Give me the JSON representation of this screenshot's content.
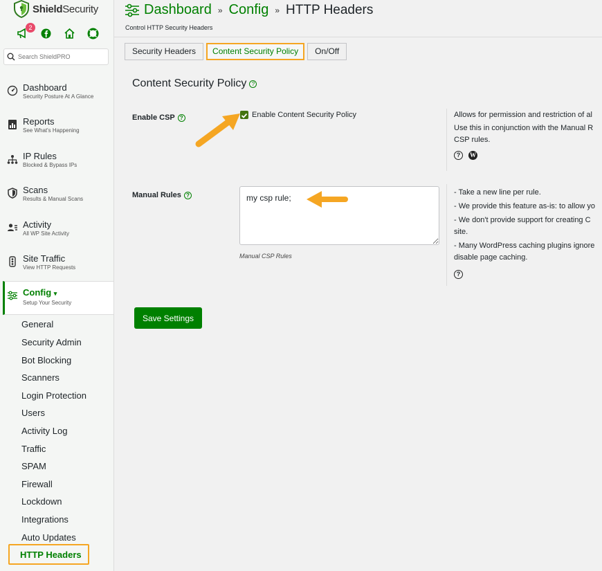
{
  "brand": {
    "name_a": "Shield",
    "name_b": "Security",
    "accent": "#008000",
    "highlight": "#f5a623"
  },
  "top_icons": {
    "notifications_count": "2",
    "icons": [
      "megaphone-icon",
      "facebook-icon",
      "home-icon",
      "support-icon"
    ]
  },
  "search": {
    "placeholder": "Search ShieldPRO"
  },
  "nav": [
    {
      "title": "Dashboard",
      "sub": "Security Posture At A Glance",
      "icon": "gauge-icon"
    },
    {
      "title": "Reports",
      "sub": "See What's Happening",
      "icon": "report-icon"
    },
    {
      "title": "IP Rules",
      "sub": "Blocked & Bypass IPs",
      "icon": "network-icon"
    },
    {
      "title": "Scans",
      "sub": "Results & Manual Scans",
      "icon": "shield-icon"
    },
    {
      "title": "Activity",
      "sub": "All WP Site Activity",
      "icon": "user-list-icon"
    },
    {
      "title": "Site Traffic",
      "sub": "View HTTP Requests",
      "icon": "traffic-icon"
    },
    {
      "title": "Config",
      "sub": "Setup Your Security",
      "icon": "sliders-icon"
    }
  ],
  "config_caret": "▾",
  "config_items": [
    "General",
    "Security Admin",
    "Bot Blocking",
    "Scanners",
    "Login Protection",
    "Users",
    "Activity Log",
    "Traffic",
    "SPAM",
    "Firewall",
    "Lockdown",
    "Integrations",
    "Auto Updates",
    "HTTP Headers"
  ],
  "breadcrumb": {
    "first": "Dashboard",
    "second": "Config",
    "current": "HTTP Headers",
    "sep": "»"
  },
  "page_description": "Control HTTP Security Headers",
  "tabs": [
    "Security Headers",
    "Content Security Policy",
    "On/Off"
  ],
  "section_title": "Content Security Policy",
  "help_glyph": "?",
  "enable_csp": {
    "label": "Enable CSP",
    "checkbox_label": "Enable Content Security Policy",
    "checked": true,
    "desc": [
      "Allows for permission and restriction of al",
      "Use this in conjunction with the Manual R",
      "CSP rules."
    ]
  },
  "manual_rules": {
    "label": "Manual Rules",
    "value": "my csp rule;",
    "hint": "Manual CSP Rules",
    "desc": [
      "- Take a new line per rule.",
      "- We provide this feature as-is: to allow yo",
      "- We don't provide support for creating C",
      "site.",
      "- Many WordPress caching plugins ignore",
      "disable page caching."
    ]
  },
  "save_label": "Save Settings",
  "wp_glyph": "W"
}
